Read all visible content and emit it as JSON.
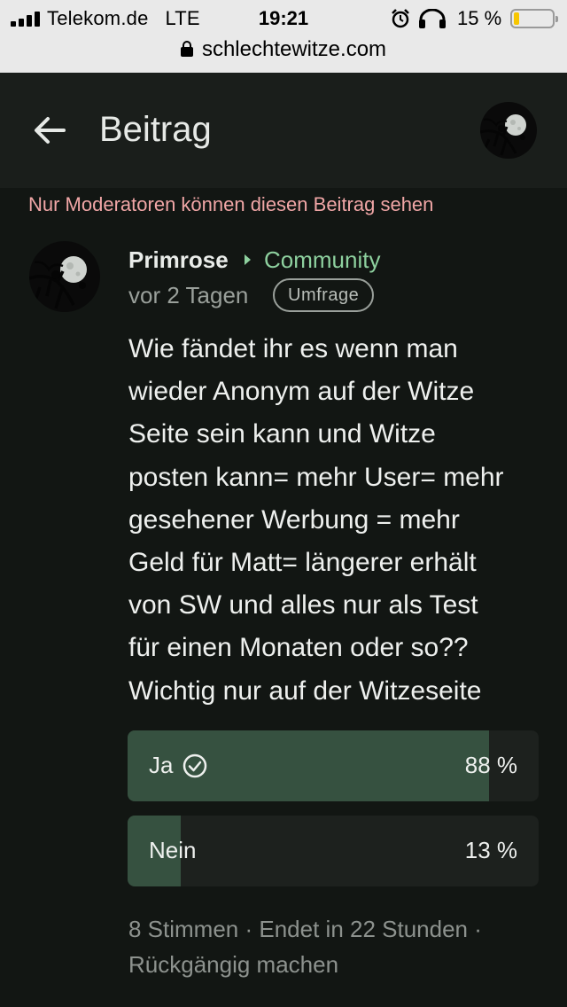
{
  "status_bar": {
    "carrier": "Telekom.de",
    "network": "LTE",
    "time": "19:21",
    "battery_percent": "15 %",
    "battery_level": 0.15,
    "icons": [
      "signal-icon",
      "alarm-icon",
      "headphones-icon",
      "battery-icon"
    ]
  },
  "url_bar": {
    "url": "schlechtewitze.com",
    "icon": "lock-icon"
  },
  "header": {
    "title": "Beitrag",
    "back_icon": "arrow-left-icon"
  },
  "moderation_notice": "Nur Moderatoren können diesen Beitrag sehen",
  "post": {
    "author": "Primrose",
    "community": "Community",
    "time_ago": "vor 2 Tagen",
    "tag": "Umfrage",
    "body_lines": [
      "Wie fändet ihr es wenn man",
      "wieder Anonym auf der Witze",
      "Seite sein kann und Witze",
      "posten kann= mehr User= mehr",
      "gesehener Werbung = mehr",
      "Geld für Matt= längerer erhält",
      "von SW und alles nur als Test",
      "für einen Monaten oder so??",
      "Wichtig nur auf der Witzeseite"
    ]
  },
  "poll": {
    "options": [
      {
        "label": "Ja",
        "percent": "88 %",
        "value": 0.88,
        "selected": true
      },
      {
        "label": "Nein",
        "percent": "13 %",
        "value": 0.13,
        "selected": false
      }
    ],
    "votes": "8 Stimmen",
    "ends": "Endet in 22 Stunden",
    "undo": "Rückgängig machen"
  },
  "colors": {
    "background": "#121613",
    "header": "#1a1e1b",
    "accent": "#8ed19f",
    "notice": "#f0a6a6",
    "poll_fill": "#365140",
    "poll_track": "#1d211e",
    "battery": "#f7c600"
  }
}
